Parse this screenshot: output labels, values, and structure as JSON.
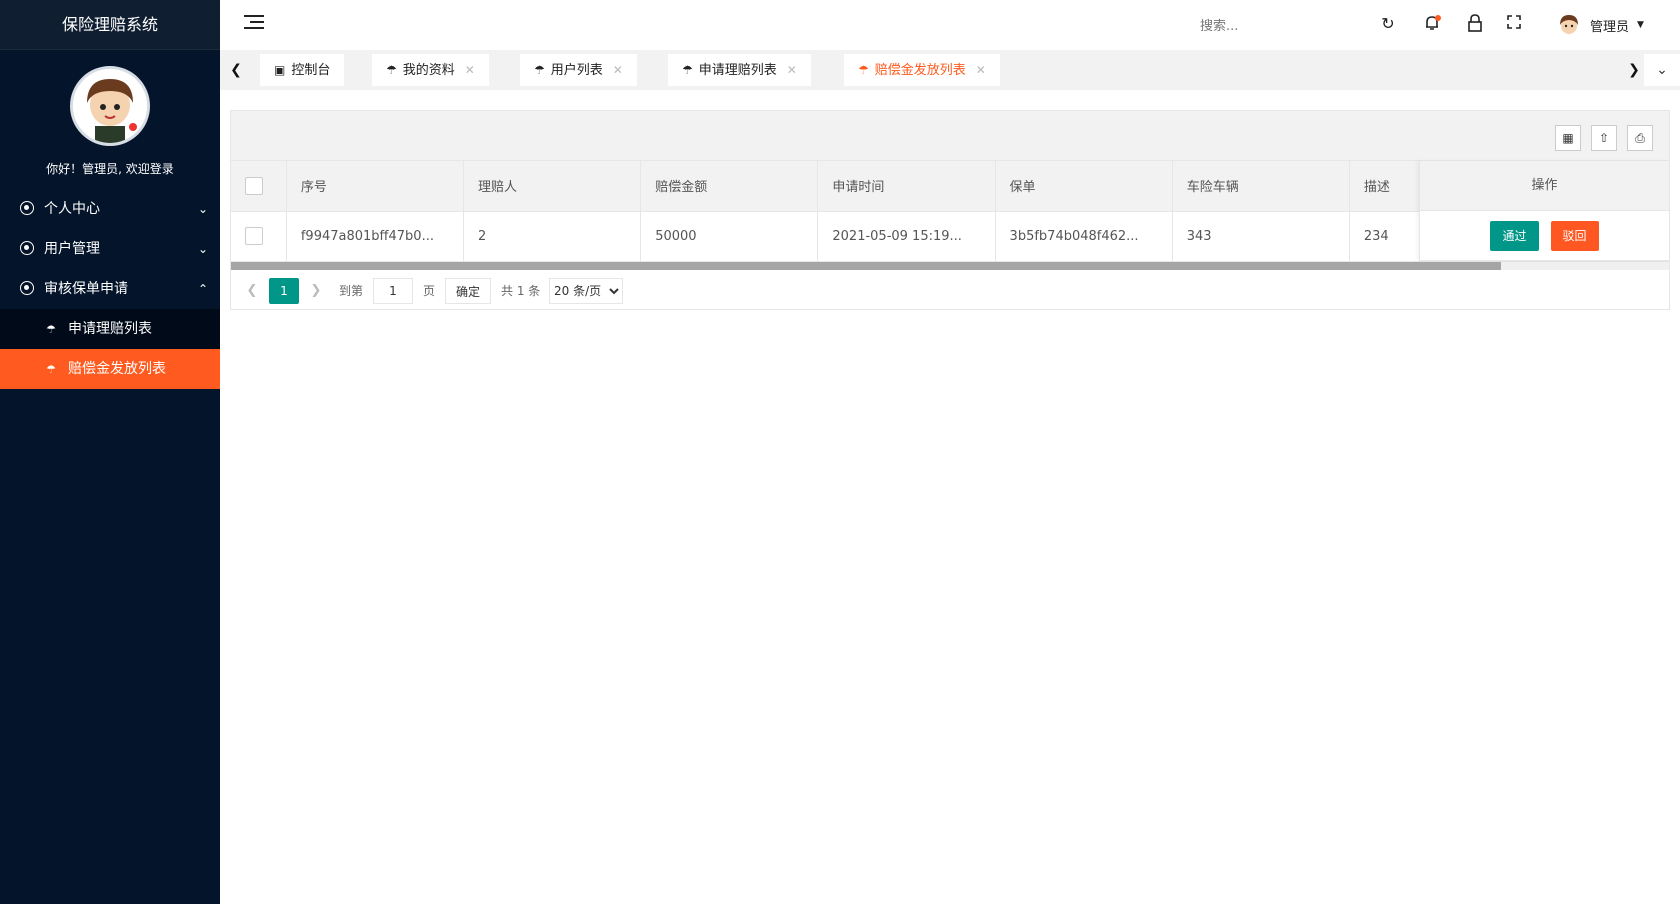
{
  "app": {
    "title": "保险理赔系统",
    "welcome": "你好！管理员, 欢迎登录"
  },
  "sidebar": {
    "items": [
      {
        "label": "个人中心",
        "chevron": "chevron-down"
      },
      {
        "label": "用户管理",
        "chevron": "chevron-down"
      },
      {
        "label": "审核保单申请",
        "chevron": "chevron-up"
      }
    ],
    "subitems": [
      {
        "label": "申请理赔列表",
        "active": false
      },
      {
        "label": "赔偿金发放列表",
        "active": true
      }
    ]
  },
  "header": {
    "search_placeholder": "搜索...",
    "user_name": "管理员",
    "icons": [
      "refresh-icon",
      "bell-icon",
      "lock-icon",
      "fullscreen-icon"
    ]
  },
  "tabs": [
    {
      "label": "控制台",
      "icon": "monitor-icon",
      "closable": false
    },
    {
      "label": "我的资料",
      "icon": "umbrella-icon",
      "closable": true
    },
    {
      "label": "用户列表",
      "icon": "umbrella-icon",
      "closable": true
    },
    {
      "label": "申请理赔列表",
      "icon": "umbrella-icon",
      "closable": true
    },
    {
      "label": "赔偿金发放列表",
      "icon": "umbrella-icon",
      "closable": true,
      "active": true
    }
  ],
  "table": {
    "headers": [
      "序号",
      "理赔人",
      "赔偿金额",
      "申请时间",
      "保单",
      "车险车辆",
      "描述",
      "操作"
    ],
    "rows": [
      [
        "f9947a801bff47b0...",
        "2",
        "50000",
        "2021-05-09 15:19...",
        "3b5fb74b048f462...",
        "343",
        "234"
      ]
    ],
    "actions": {
      "pass": "通过",
      "reject": "驳回"
    }
  },
  "pager": {
    "current": "1",
    "goto_label": "到第",
    "page_value": "1",
    "page_unit": "页",
    "confirm": "确定",
    "total": "共 1 条",
    "page_size": "20 条/页"
  },
  "colors": {
    "accent": "#ff5a1f",
    "sidebar_bg": "#04152b",
    "teal": "#009688"
  }
}
